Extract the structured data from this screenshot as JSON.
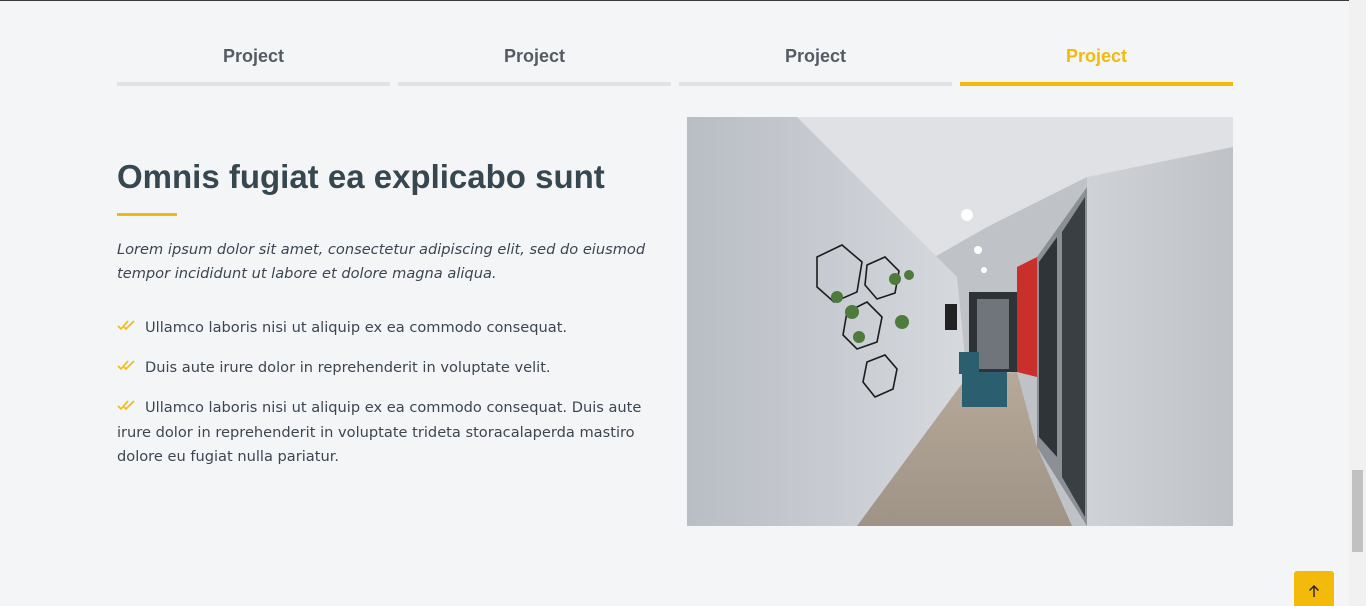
{
  "tabs": [
    {
      "label": "Project",
      "active": false
    },
    {
      "label": "Project",
      "active": false
    },
    {
      "label": "Project",
      "active": false
    },
    {
      "label": "Project",
      "active": true
    }
  ],
  "content": {
    "title": "Omnis fugiat ea explicabo sunt",
    "lead": "Lorem ipsum dolor sit amet, consectetur adipiscing elit, sed do eiusmod tempor incididunt ut labore et dolore magna aliqua.",
    "items": [
      "Ullamco laboris nisi ut aliquip ex ea commodo consequat.",
      "Duis aute irure dolor in reprehenderit in voluptate velit.",
      "Ullamco laboris nisi ut aliquip ex ea commodo consequat. Duis aute irure dolor in reprehenderit in voluptate trideta storacalaperda mastiro dolore eu fugiat nulla pariatur."
    ],
    "image_description_icon": "office-corridor-photo"
  },
  "colors": {
    "accent": "#f3b90b",
    "heading": "#37474f",
    "text": "#3c4650",
    "tab_inactive": "#555b63",
    "background": "#f4f5f7"
  },
  "back_to_top": {
    "icon": "arrow-up-icon"
  }
}
